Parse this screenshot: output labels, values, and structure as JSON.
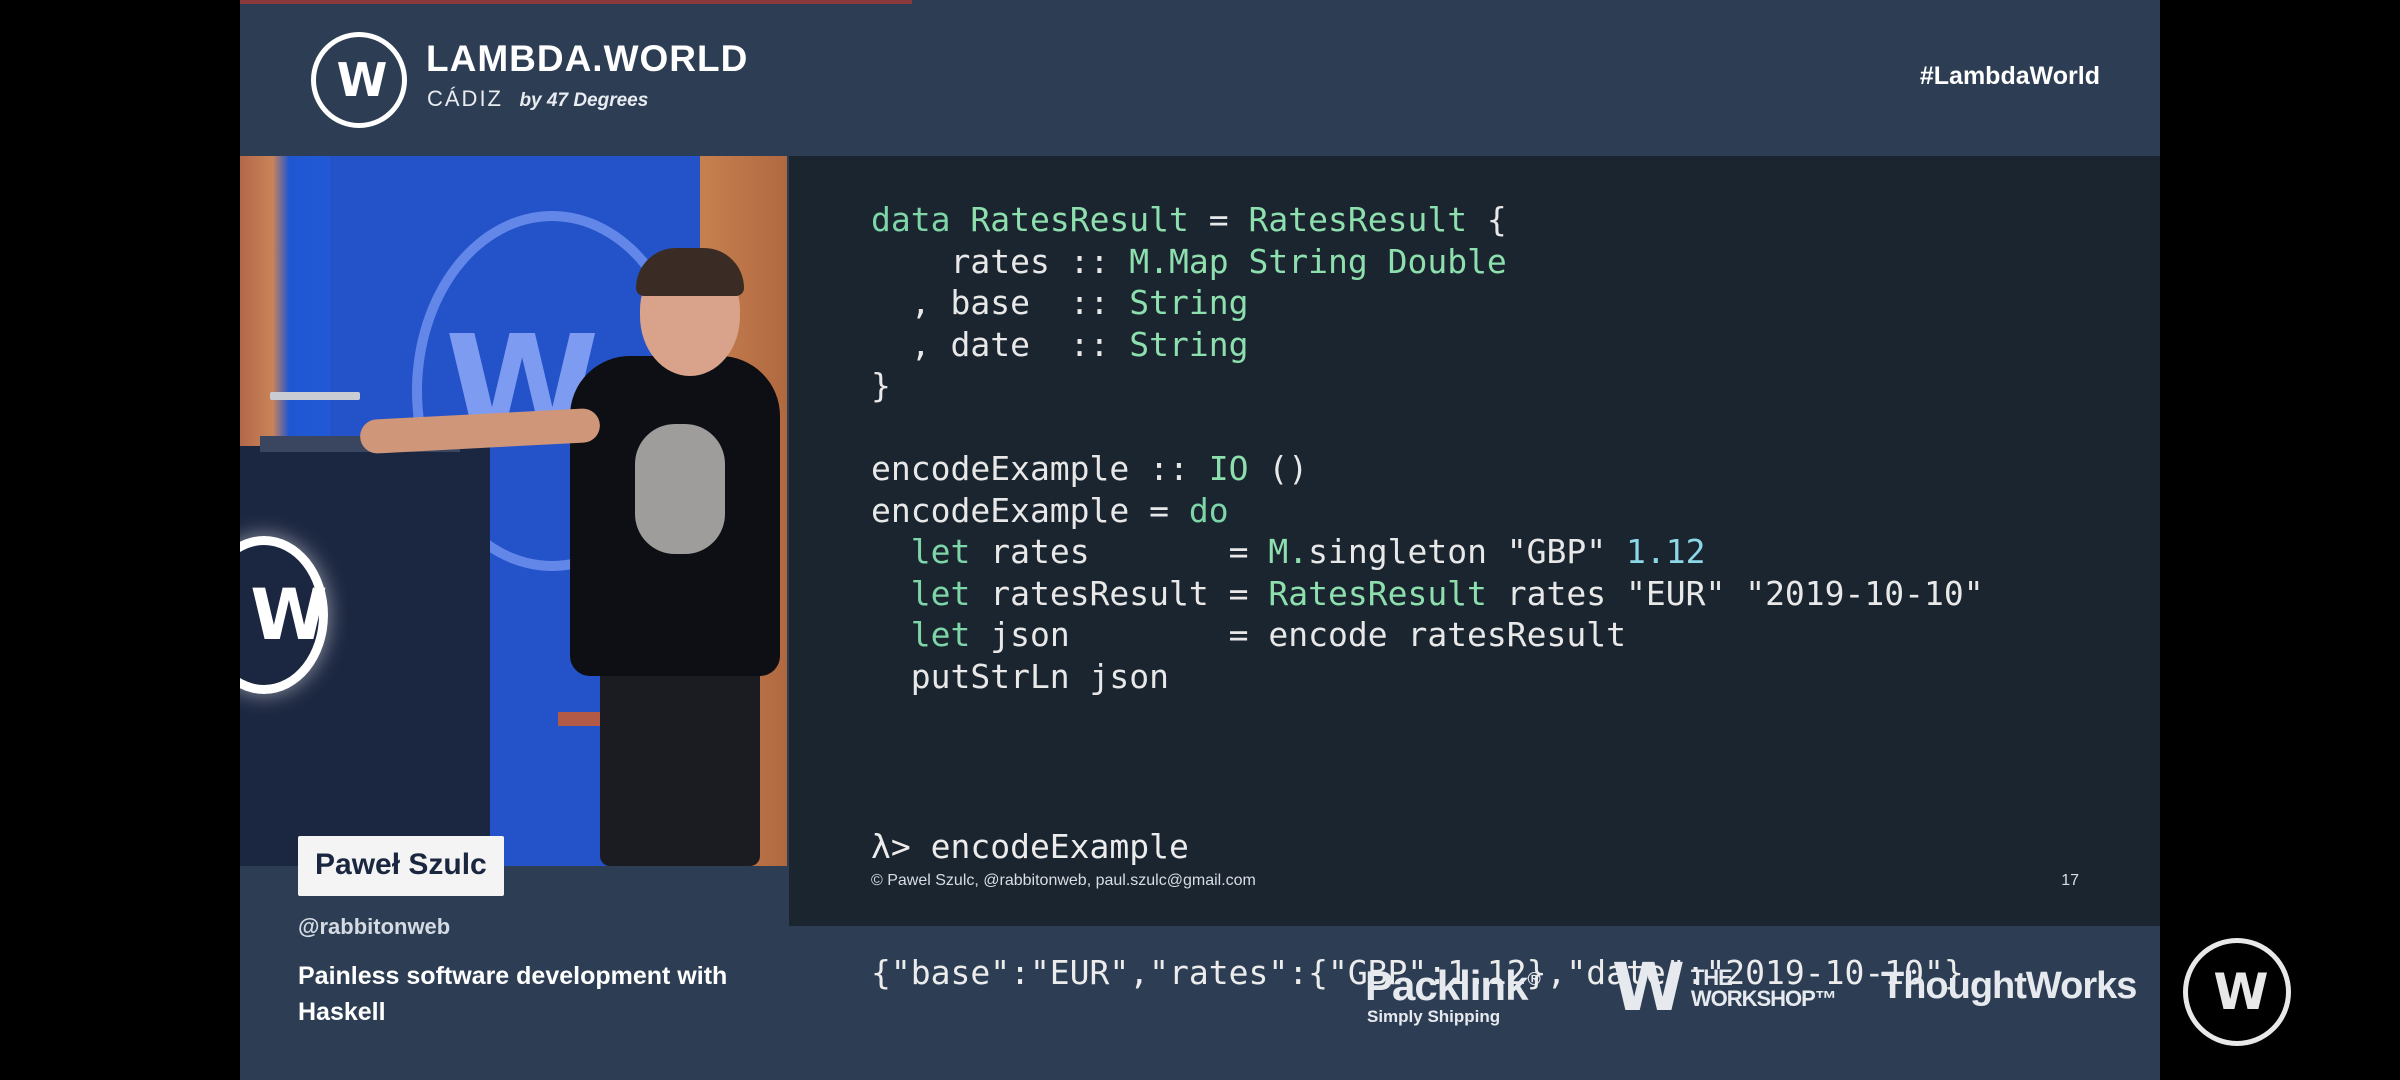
{
  "header": {
    "brand_title": "LAMBDA.WORLD",
    "brand_city": "CÁDIZ",
    "brand_by": "by 47 Degrees",
    "logo_letter": "W",
    "hashtag": "#LambdaWorld"
  },
  "video": {
    "progress_fraction": 0.35,
    "stage_logo_letter": "W",
    "podium_logo_letter": "W"
  },
  "speaker": {
    "name": "Paweł Szulc",
    "handle": "@rabbitonweb",
    "talk_title": "Painless software development with Haskell"
  },
  "slide": {
    "code_lines": [
      "data RatesResult = RatesResult {",
      "    rates :: M.Map String Double",
      "  , base  :: String",
      "  , date  :: String",
      "}",
      "",
      "encodeExample :: IO ()",
      "encodeExample = do",
      "  let rates       = M.singleton \"GBP\" 1.12",
      "  let ratesResult = RatesResult rates \"EUR\" \"2019-10-10\"",
      "  let json        = encode ratesResult",
      "  putStrLn json"
    ],
    "repl_prompt": "λ> encodeExample",
    "repl_output": "{\"base\":\"EUR\",\"rates\":{\"GBP\":1.12},\"date\":\"2019-10-10\"}",
    "footer": "© Pawel Szulc, @rabbitonweb, paul.szulc@gmail.com",
    "page_number": "17"
  },
  "sponsors": {
    "packlink_name": "Packlink",
    "packlink_mark": "®",
    "packlink_sub": "Simply Shipping",
    "workshop_letter": "W",
    "workshop_name_line1": "THE",
    "workshop_name_line2": "WORKSHOP™",
    "thoughtworks": "ThoughtWorks"
  },
  "player_badge_letter": "W",
  "colors": {
    "background": "#2d3e54",
    "slide_background": "#1b2530",
    "keyword": "#7ed6a8",
    "number": "#8cd8e6"
  }
}
